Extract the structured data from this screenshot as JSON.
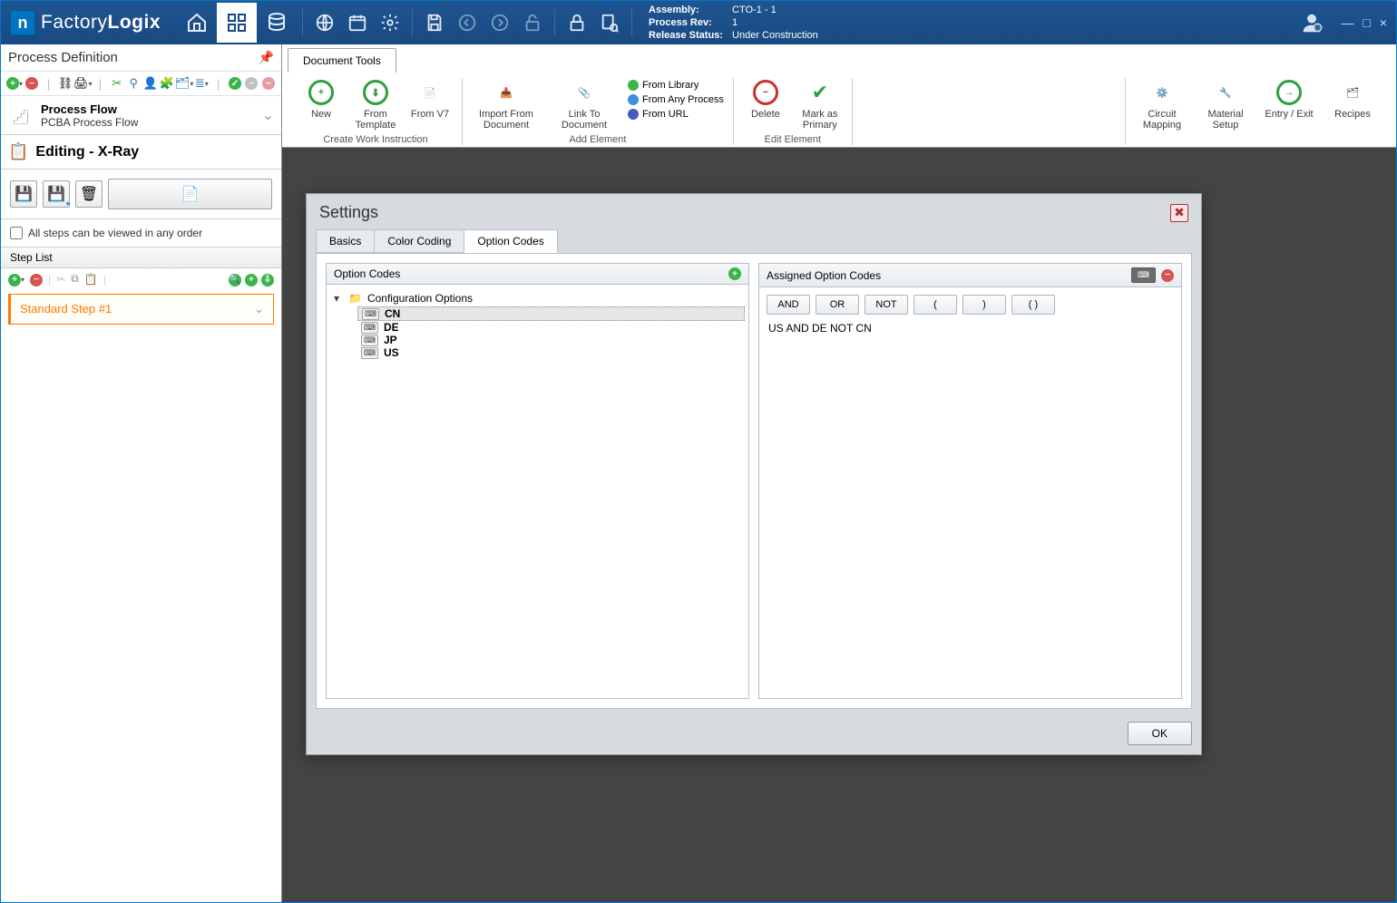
{
  "brand_a": "Factory",
  "brand_b": "Logix",
  "meta": {
    "assembly_k": "Assembly:",
    "assembly_v": "CTO-1 - 1",
    "rev_k": "Process Rev:",
    "rev_v": "1",
    "status_k": "Release Status:",
    "status_v": "Under Construction"
  },
  "left": {
    "title": "Process Definition",
    "pf_title": "Process Flow",
    "pf_sub": "PCBA Process Flow",
    "editing": "Editing - X-Ray",
    "anyorder": "All steps can be viewed in any order",
    "steplist": "Step List",
    "step1": "Standard Step #1"
  },
  "doc_tab": "Document Tools",
  "ribbon": {
    "g1": {
      "new": "New",
      "tmpl": "From Template",
      "v7": "From V7",
      "cap": "Create Work Instruction"
    },
    "g2": {
      "impdoc": "Import From Document",
      "linkdoc": "Link To Document",
      "lib": "From Library",
      "anyproc": "From Any Process",
      "url": "From URL",
      "cap": "Add Element"
    },
    "g3": {
      "del": "Delete",
      "primary": "Mark as Primary",
      "cap": "Edit Element"
    },
    "g4": {
      "cm": "Circuit Mapping",
      "ms": "Material Setup",
      "ee": "Entry / Exit",
      "rec": "Recipes"
    }
  },
  "modal": {
    "title": "Settings",
    "tabs": {
      "basics": "Basics",
      "cc": "Color Coding",
      "oc": "Option Codes"
    },
    "left_h": "Option Codes",
    "tree_root": "Configuration Options",
    "opts": {
      "cn": "CN",
      "de": "DE",
      "jp": "JP",
      "us": "US"
    },
    "right_h": "Assigned Option Codes",
    "ops": {
      "and": "AND",
      "or": "OR",
      "not": "NOT",
      "lp": "(",
      "rp": ")",
      "pp": "( )"
    },
    "expr": "US AND DE NOT CN",
    "ok": "OK"
  }
}
